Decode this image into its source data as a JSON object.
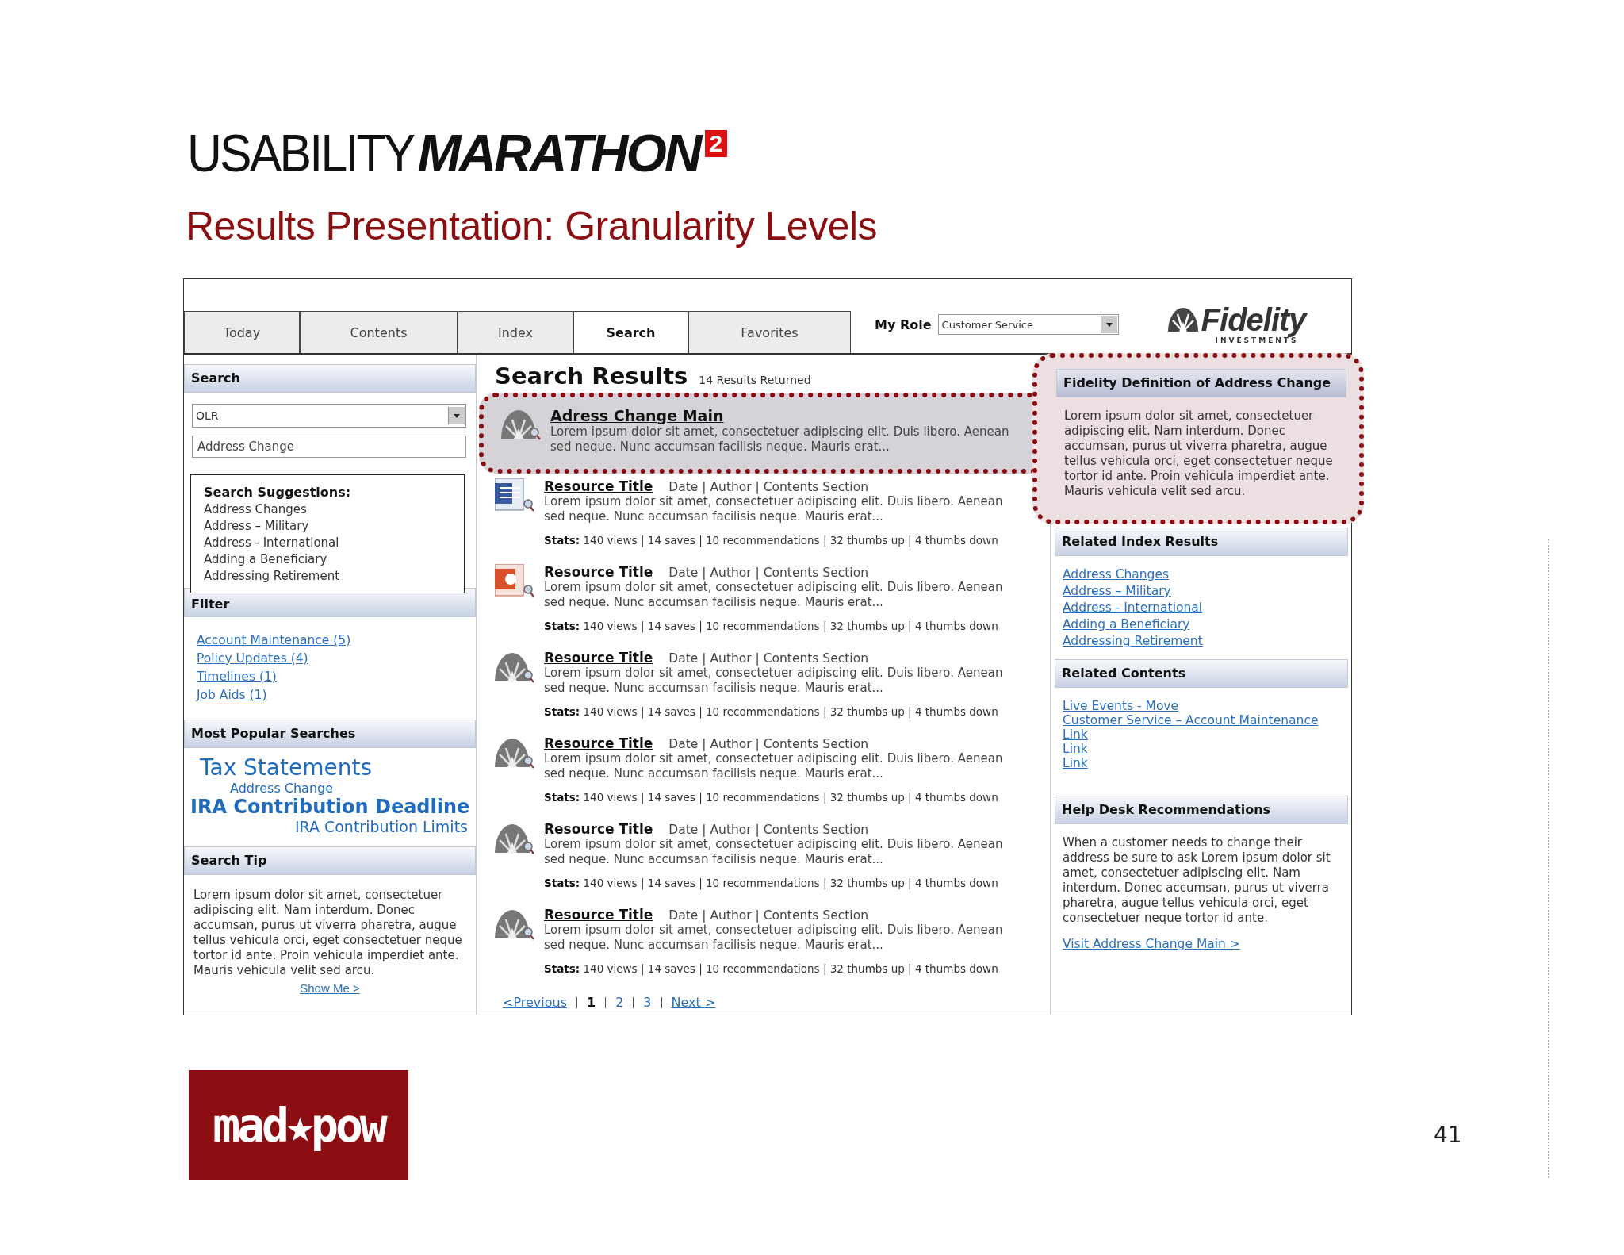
{
  "slide": {
    "logo": {
      "light": "USABILITY",
      "bold": "MARATHON",
      "badge": "2"
    },
    "title": "Results Presentation: Granularity Levels",
    "footer_logo": "mad★pow",
    "page_number": "41"
  },
  "tabs": [
    {
      "label": "Today",
      "selected": false
    },
    {
      "label": "Contents",
      "selected": false
    },
    {
      "label": "Index",
      "selected": false
    },
    {
      "label": "Search",
      "selected": true
    },
    {
      "label": "Favorites",
      "selected": false
    }
  ],
  "role": {
    "label": "My Role",
    "value": "Customer Service"
  },
  "brand": {
    "name": "Fidelity",
    "tagline": "INVESTMENTS"
  },
  "left": {
    "search": {
      "title": "Search",
      "source": "OLR",
      "query": "Address Change",
      "suggestions_title": "Search Suggestions:",
      "suggestions": [
        "Address Changes",
        "Address – Military",
        "Address - International",
        "Adding a Beneficiary",
        "Addressing Retirement"
      ]
    },
    "filter": {
      "title": "Filter",
      "links": [
        "Account Maintenance (5)",
        "Policy Updates (4)",
        "Timelines (1)",
        "Job Aids (1)"
      ]
    },
    "popular": {
      "title": "Most Popular Searches",
      "terms": [
        {
          "text": "Tax Statements",
          "kind": "large"
        },
        {
          "text": "Address Change",
          "kind": "small"
        },
        {
          "text": "IRA Contribution Deadline",
          "kind": "bold"
        },
        {
          "text": "IRA Contribution Limits",
          "kind": "medium"
        }
      ]
    },
    "tip": {
      "title": "Search Tip",
      "text": "Lorem ipsum dolor sit amet, consectetuer adipiscing elit. Nam interdum. Donec accumsan, purus ut viverra pharetra, augue tellus vehicula orci, eget consectetuer neque tortor id ante. Proin vehicula imperdiet ante. Mauris vehicula velit sed arcu.",
      "link": "Show Me >"
    }
  },
  "results": {
    "title": "Search Results",
    "count": "14 Results Returned",
    "items": [
      {
        "kind": "featured",
        "highlighted": true,
        "title": "Adress Change Main",
        "description": "Lorem ipsum dolor sit amet, consectetuer adipiscing elit. Duis libero. Aenean sed neque. Nunc accumsan facilisis neque. Mauris erat..."
      },
      {
        "kind": "word",
        "highlighted": false,
        "title": "Resource Title",
        "meta": "Date | Author | Contents Section",
        "description": "Lorem ipsum dolor sit amet, consectetuer adipiscing elit. Duis libero. Aenean sed neque. Nunc accumsan facilisis neque. Mauris erat...",
        "stats": "**Stats:** 140 views | 14 saves | 10 recommendations | 32 thumbs up | 4 thumbs down"
      },
      {
        "kind": "powerpoint",
        "highlighted": false,
        "title": "Resource Title",
        "meta": "Date | Author | Contents Section",
        "description": "Lorem ipsum dolor sit amet, consectetuer adipiscing elit. Duis libero. Aenean sed neque. Nunc accumsan facilisis neque. Mauris erat...",
        "stats": "**Stats:** 140 views | 14 saves | 10 recommendations | 32 thumbs up | 4 thumbs down"
      },
      {
        "kind": "resource",
        "highlighted": false,
        "title": "Resource Title",
        "meta": "Date | Author | Contents Section",
        "description": "Lorem ipsum dolor sit amet, consectetuer adipiscing elit. Duis libero. Aenean sed neque. Nunc accumsan facilisis neque. Mauris erat...",
        "stats": "**Stats:** 140 views | 14 saves | 10 recommendations | 32 thumbs up | 4 thumbs down"
      },
      {
        "kind": "resource",
        "highlighted": false,
        "title": "Resource Title",
        "meta": "Date | Author | Contents Section",
        "description": "Lorem ipsum dolor sit amet, consectetuer adipiscing elit. Duis libero. Aenean sed neque. Nunc accumsan facilisis neque. Mauris erat...",
        "stats": "**Stats:** 140 views | 14 saves | 10 recommendations | 32 thumbs up | 4 thumbs down"
      },
      {
        "kind": "resource",
        "highlighted": false,
        "title": "Resource Title",
        "meta": "Date | Author | Contents Section",
        "description": "Lorem ipsum dolor sit amet, consectetuer adipiscing elit. Duis libero. Aenean sed neque. Nunc accumsan facilisis neque. Mauris erat...",
        "stats": "**Stats:** 140 views | 14 saves | 10 recommendations | 32 thumbs up | 4 thumbs down"
      },
      {
        "kind": "resource",
        "highlighted": false,
        "title": "Resource Title",
        "meta": "Date | Author | Contents Section",
        "description": "Lorem ipsum dolor sit amet, consectetuer adipiscing elit. Duis libero. Aenean sed neque. Nunc accumsan facilisis neque. Mauris erat...",
        "stats": "**Stats:** 140 views | 14 saves | 10 recommendations | 32 thumbs up | 4 thumbs down"
      }
    ],
    "pagination": [
      {
        "label": "<Previous",
        "kind": "nav",
        "selected": false
      },
      {
        "label": "1",
        "kind": "page",
        "selected": true
      },
      {
        "label": "2",
        "kind": "page",
        "selected": false
      },
      {
        "label": "3",
        "kind": "page",
        "selected": false
      },
      {
        "label": "Next >",
        "kind": "nav",
        "selected": false
      }
    ]
  },
  "right": {
    "definition": {
      "title": "Fidelity Definition of Address Change",
      "highlighted": true,
      "text": "Lorem ipsum dolor sit amet, consectetuer adipiscing elit. Nam interdum. Donec accumsan, purus ut viverra pharetra, augue tellus vehicula orci, eget consectetuer neque tortor id ante. Proin vehicula imperdiet ante. Mauris vehicula velit sed arcu."
    },
    "index": {
      "title": "Related Index Results",
      "links": [
        "Address Changes",
        "Address – Military",
        "Address - International",
        "Adding a Beneficiary",
        "Addressing Retirement"
      ]
    },
    "contents": {
      "title": "Related Contents",
      "links": [
        "Live Events - Move",
        "Customer Service – Account Maintenance",
        "Link",
        "Link",
        "Link"
      ]
    },
    "helpdesk": {
      "title": "Help Desk Recommendations",
      "text": "When a customer needs to change their address be sure to ask Lorem ipsum dolor sit amet, consectetuer adipiscing elit. Nam interdum. Donec accumsan, purus ut viverra pharetra, augue tellus vehicula orci, eget consectetuer neque tortor id ante.",
      "link": "Visit Address Change Main >"
    }
  }
}
